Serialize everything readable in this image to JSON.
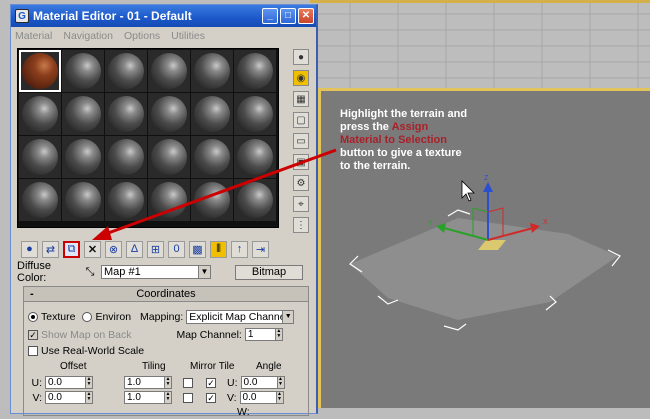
{
  "window": {
    "title": "Material Editor - 01 - Default",
    "app_icon": "G",
    "controls": {
      "minimize": "_",
      "maximize": "□",
      "close": "✕"
    }
  },
  "menu": [
    "Material",
    "Navigation",
    "Options",
    "Utilities"
  ],
  "sample_slots": {
    "count": 24,
    "active_index": 0
  },
  "side_tools": [
    {
      "name": "sample-type-sphere-icon",
      "glyph": "●"
    },
    {
      "name": "backlight-icon",
      "glyph": "◉"
    },
    {
      "name": "background-checker-icon",
      "glyph": "▦"
    },
    {
      "name": "sample-uv-tiling-icon",
      "glyph": "▢"
    },
    {
      "name": "video-color-check-icon",
      "glyph": "▭"
    },
    {
      "name": "make-preview-icon",
      "glyph": "▣"
    },
    {
      "name": "options-icon",
      "glyph": "⚙"
    },
    {
      "name": "select-by-material-icon",
      "glyph": "⌖"
    },
    {
      "name": "material-map-navigator-icon",
      "glyph": "⋮"
    }
  ],
  "toolbar": [
    {
      "name": "get-material-button",
      "glyph": "●"
    },
    {
      "name": "put-to-scene-button",
      "glyph": "⇄"
    },
    {
      "name": "assign-material-to-selection-button",
      "glyph": "⧉",
      "highlight": true
    },
    {
      "name": "reset-map-button",
      "glyph": "✕"
    },
    {
      "name": "make-material-copy-button",
      "glyph": "⊗"
    },
    {
      "name": "make-unique-button",
      "glyph": "∆"
    },
    {
      "name": "put-to-library-button",
      "glyph": "⊞"
    },
    {
      "name": "material-effects-channel-button",
      "glyph": "0"
    },
    {
      "name": "show-map-in-viewport-button",
      "glyph": "▩"
    },
    {
      "name": "show-end-result-button",
      "glyph": "⫴",
      "pressed": true
    },
    {
      "name": "go-to-parent-button",
      "glyph": "↑"
    },
    {
      "name": "go-forward-to-sibling-button",
      "glyph": "⇥"
    }
  ],
  "diffuse": {
    "label": "Diffuse Color:",
    "map_name": "Map #1",
    "bitmap_button": "Bitmap"
  },
  "coordinates": {
    "title": "Coordinates",
    "collapse": "-",
    "texture_label": "Texture",
    "environ_label": "Environ",
    "mapping_label": "Mapping:",
    "mapping_value": "Explicit Map Channel",
    "show_map_on_back": "Show Map on Back",
    "map_channel_label": "Map Channel:",
    "map_channel_value": "1",
    "real_world_scale": "Use Real-World Scale",
    "headers": {
      "offset": "Offset",
      "tiling": "Tiling",
      "mirror_tile": "Mirror Tile",
      "angle": "Angle"
    },
    "u": {
      "label": "U:",
      "offset": "0.0",
      "tiling": "1.0",
      "angle_label": "U:",
      "angle": "0.0"
    },
    "v": {
      "label": "V:",
      "offset": "0.0",
      "tiling": "1.0",
      "angle_label": "V:",
      "angle": "0.0"
    },
    "w": {
      "angle_label": "W:"
    }
  },
  "annotation": {
    "part1": "Highlight the terrain and press the ",
    "highlight": "Assign Material to Selection",
    "part2": " button to give a texture to the terrain."
  },
  "gizmo_axes": {
    "x": "X",
    "y": "Y",
    "z": "Z"
  },
  "colors": {
    "title_bar": "#1c58c9",
    "annotation_highlight": "#a8212a",
    "arrow": "#cc0000",
    "viewport_border": "#e3c45a"
  }
}
